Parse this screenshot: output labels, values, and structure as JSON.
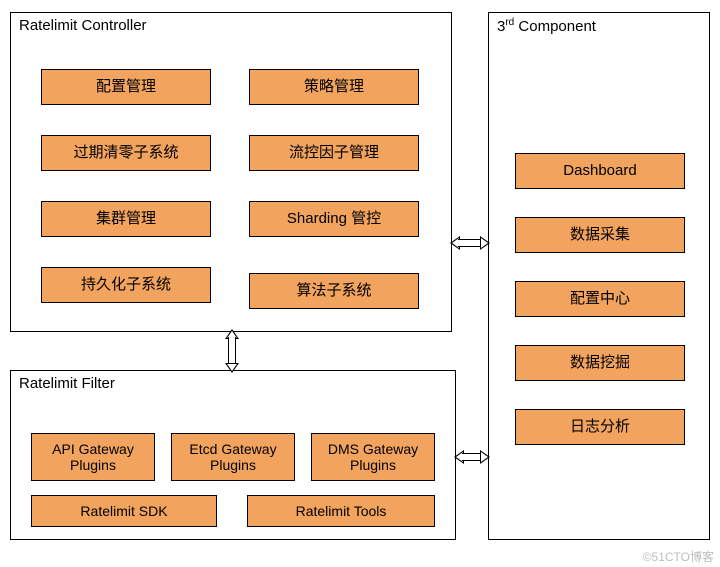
{
  "colors": {
    "box_fill": "#f2a35e",
    "border": "#000000"
  },
  "controller": {
    "title": "Ratelimit Controller",
    "boxes": {
      "config_mgmt": "配置管理",
      "policy_mgmt": "策略管理",
      "expire_clear_subsys": "过期清零子系统",
      "flow_factor_mgmt": "流控因子管理",
      "cluster_mgmt": "集群管理",
      "sharding_ctrl": "Sharding 管控",
      "persistence_subsys": "持久化子系统",
      "algorithm_subsys": "算法子系统"
    }
  },
  "filter": {
    "title": "Ratelimit Filter",
    "boxes": {
      "api_gw_plugins": "API Gateway Plugins",
      "etcd_gw_plugins": "Etcd Gateway Plugins",
      "dms_gw_plugins": "DMS Gateway Plugins",
      "ratelimit_sdk": "Ratelimit SDK",
      "ratelimit_tools": "Ratelimit Tools"
    }
  },
  "third": {
    "title_prefix": "3",
    "title_sup": "rd",
    "title_suffix": " Component",
    "boxes": {
      "dashboard": "Dashboard",
      "data_collect": "数据采集",
      "config_center": "配置中心",
      "data_mining": "数据挖掘",
      "log_analysis": "日志分析"
    }
  },
  "watermark": "©51CTO博客"
}
